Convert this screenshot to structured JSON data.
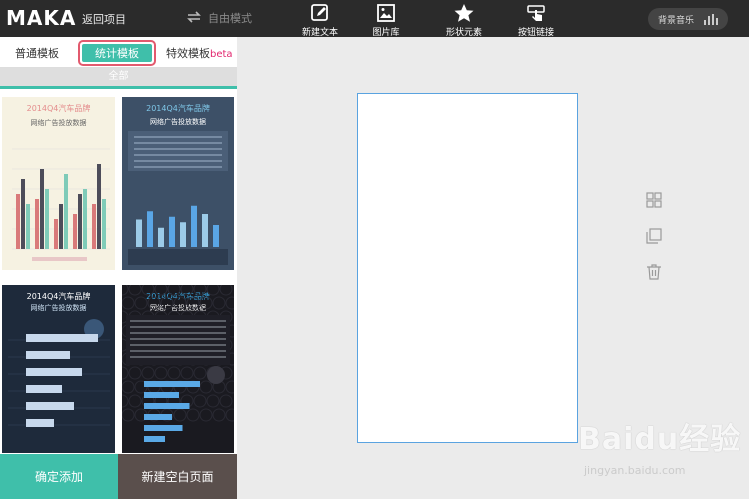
{
  "app": {
    "logo": "MAKA",
    "back_label": "返回项目",
    "free_mode_label": "自由模式"
  },
  "toolbar": {
    "items": [
      {
        "label": "新建文本",
        "icon": "edit-icon"
      },
      {
        "label": "图片库",
        "icon": "image-icon"
      },
      {
        "label": "形状元素",
        "icon": "star-icon"
      },
      {
        "label": "按钮链接",
        "icon": "pointer-hand-icon"
      }
    ],
    "music_label": "背景音乐"
  },
  "panel": {
    "tabs": [
      {
        "label": "普通模板",
        "active": false
      },
      {
        "label": "统计模板",
        "active": true
      },
      {
        "label": "特效模板",
        "badge": "beta",
        "active": false
      }
    ],
    "filter_label": "全部",
    "templates": [
      {
        "title": "2014Q4汽车品牌",
        "subtitle": "网络广告投放数据",
        "bars": [
          {
            "heights": [
              0.55,
              0.7,
              0.45
            ],
            "colors": [
              "#d97a7a",
              "#4d4d5a",
              "#7fcbb8"
            ]
          },
          {
            "heights": [
              0.5,
              0.8,
              0.6
            ],
            "colors": [
              "#d97a7a",
              "#4d4d5a",
              "#7fcbb8"
            ]
          },
          {
            "heights": [
              0.3,
              0.45,
              0.75
            ],
            "colors": [
              "#d97a7a",
              "#4d4d5a",
              "#7fcbb8"
            ]
          },
          {
            "heights": [
              0.35,
              0.55,
              0.6
            ],
            "colors": [
              "#d97a7a",
              "#4d4d5a",
              "#7fcbb8"
            ]
          },
          {
            "heights": [
              0.45,
              0.85,
              0.5
            ],
            "colors": [
              "#d97a7a",
              "#4d4d5a",
              "#7fcbb8"
            ]
          }
        ]
      },
      {
        "title": "2014Q4汽车品牌",
        "subtitle": "网络广告投放数据",
        "bars": [
          0.5,
          0.65,
          0.35,
          0.55,
          0.45,
          0.75,
          0.6,
          0.4
        ]
      },
      {
        "title": "2014Q4汽车品牌",
        "subtitle": "网络广告投放数据",
        "hbars": [
          0.9,
          0.55,
          0.7,
          0.45,
          0.6,
          0.35
        ]
      },
      {
        "title": "2014Q4汽车品牌",
        "subtitle": "网络广告投放数据",
        "hbars": [
          0.8,
          0.5,
          0.65,
          0.4,
          0.55,
          0.3
        ]
      }
    ],
    "confirm_label": "确定添加",
    "new_page_label": "新建空白页面"
  },
  "side_tools": [
    {
      "icon": "grid-icon"
    },
    {
      "icon": "copy-icon"
    },
    {
      "icon": "trash-icon"
    }
  ],
  "watermark": {
    "text": "Baidu经验",
    "url": "jingyan.baidu.com"
  },
  "colors": {
    "accent": "#3fbfaa",
    "highlight": "#e25a6e",
    "topbar": "#2b2b2b"
  }
}
